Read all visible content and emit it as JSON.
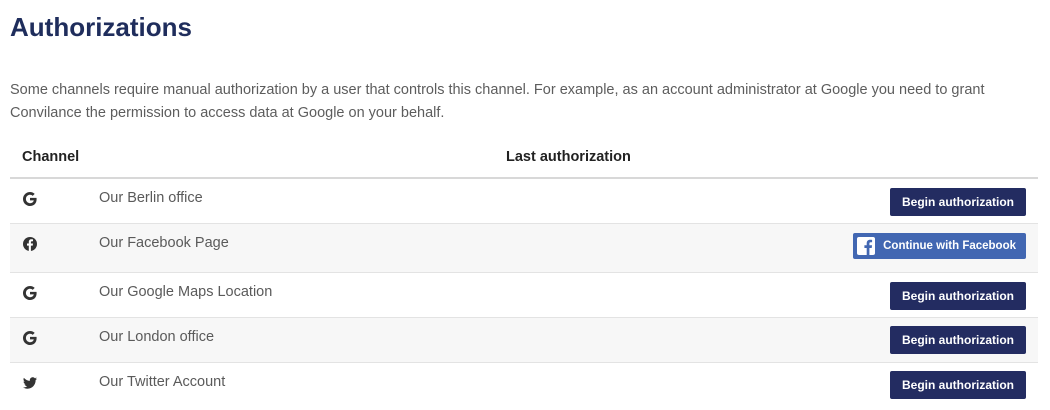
{
  "page": {
    "title": "Authorizations",
    "intro": "Some channels require manual authorization by a user that controls this channel. For example, as an account administrator at Google you need to grant Convilance the permission to access data at Google on your behalf."
  },
  "table": {
    "headers": {
      "channel": "Channel",
      "last_authorization": "Last authorization"
    },
    "rows": [
      {
        "icon": "google-icon",
        "name": "Our Berlin office",
        "action": "Begin authorization"
      },
      {
        "icon": "facebook-icon",
        "name": "Our Facebook Page",
        "action": "Continue with Facebook"
      },
      {
        "icon": "google-icon",
        "name": "Our Google Maps Location",
        "action": "Begin authorization"
      },
      {
        "icon": "google-icon",
        "name": "Our London office",
        "action": "Begin authorization"
      },
      {
        "icon": "twitter-icon",
        "name": "Our Twitter Account",
        "action": "Begin authorization"
      }
    ]
  },
  "colors": {
    "title": "#1f2d5c",
    "button": "#232c61",
    "facebook_button": "#4267b2",
    "row_alt": "#f7f7f7"
  }
}
